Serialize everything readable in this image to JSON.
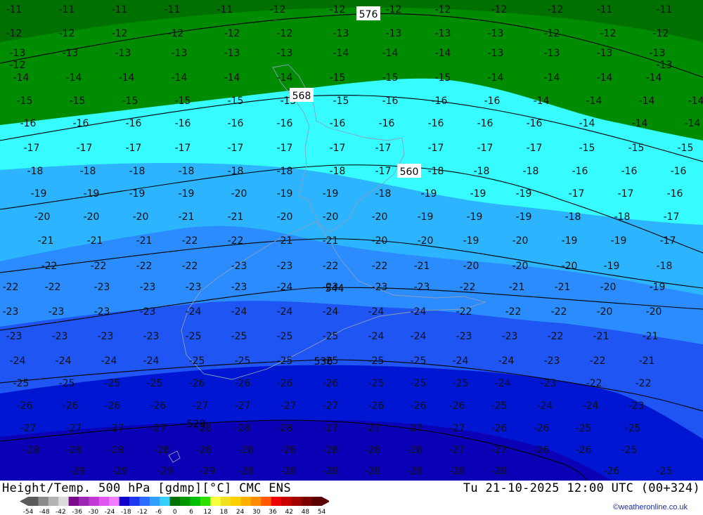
{
  "map": {
    "contour_labels": [
      "-11",
      "-12",
      "-13",
      "-14",
      "-15",
      "-16",
      "-17",
      "-18",
      "-19",
      "-20",
      "-21",
      "-22",
      "-23",
      "-24",
      "-25",
      "-26",
      "-27",
      "-28",
      "-29"
    ],
    "height_labels": [
      "576",
      "568",
      "560",
      "544",
      "536",
      "528"
    ],
    "fill_colors": {
      "dark_green": "#007000",
      "green": "#008c00",
      "cyan": "#36fcff",
      "light_blue": "#2cb4ff",
      "blue": "#2a8cff",
      "mid_blue": "#1f55f2",
      "deep_blue": "#0016d2",
      "navy": "#0c00b6"
    }
  },
  "footer": {
    "title": "Height/Temp. 500 hPa [gdmp][°C] CMC ENS",
    "datetime": "Tu 21-10-2025 12:00 UTC (00+324)",
    "credit": "©weatheronline.co.uk",
    "legend_ticks": [
      "-54",
      "-48",
      "-42",
      "-36",
      "-30",
      "-24",
      "-18",
      "-12",
      "-6",
      "0",
      "6",
      "12",
      "18",
      "24",
      "30",
      "36",
      "42",
      "48",
      "54"
    ],
    "legend_colors": [
      "#5a5a5a",
      "#8a8a8a",
      "#b4b4b4",
      "#dcdcdc",
      "#7a0b8c",
      "#9c27b0",
      "#c238d6",
      "#e056f0",
      "#f07cff",
      "#1300c8",
      "#1d37f0",
      "#2a6cff",
      "#2fa0ff",
      "#36d0ff",
      "#007000",
      "#009600",
      "#00be00",
      "#30e000",
      "#f8ff40",
      "#f0e020",
      "#ffd000",
      "#ffb000",
      "#ff8c00",
      "#ff5a00",
      "#ee0000",
      "#c80000",
      "#a00000",
      "#7c0000",
      "#5a0000"
    ]
  }
}
